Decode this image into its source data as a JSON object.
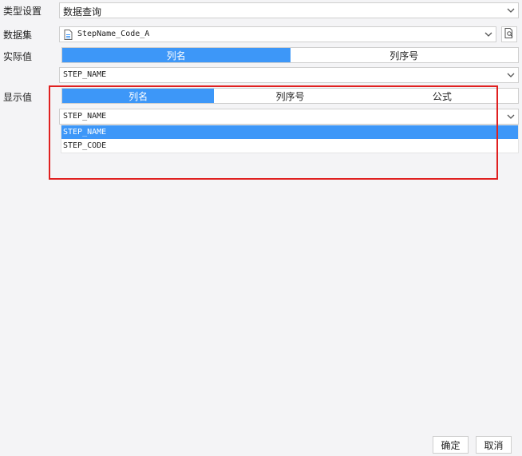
{
  "type_setting": {
    "label": "类型设置",
    "value": "数据查询"
  },
  "dataset": {
    "label": "数据集",
    "value": "StepName_Code_A"
  },
  "actual_value": {
    "label": "实际值",
    "tabs": [
      "列名",
      "列序号"
    ],
    "active_tab": 0,
    "column": "STEP_NAME"
  },
  "display_value": {
    "label": "显示值",
    "tabs": [
      "列名",
      "列序号",
      "公式"
    ],
    "active_tab": 0,
    "column": "STEP_NAME",
    "dropdown_options": [
      "STEP_NAME",
      "STEP_CODE"
    ],
    "selected_option": 0
  },
  "footer": {
    "confirm_label": "确定",
    "cancel_label": "取消"
  },
  "colors": {
    "accent": "#3d97f8",
    "highlight_border": "#e02020"
  }
}
